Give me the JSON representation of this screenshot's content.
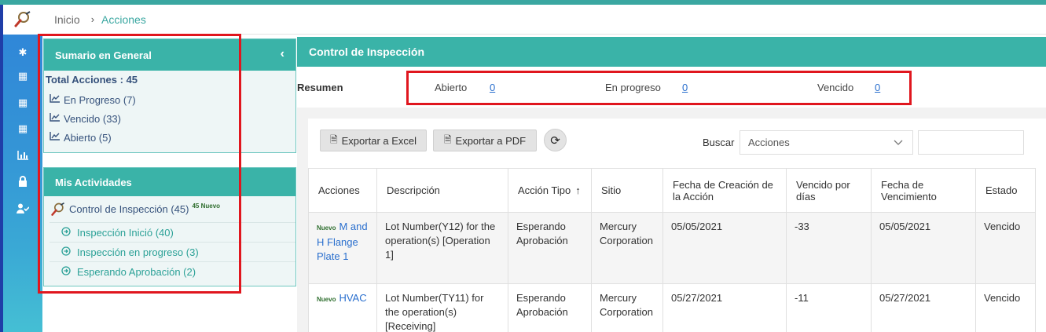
{
  "breadcrumb": {
    "home": "Inicio",
    "separator": "›",
    "current": "Acciones"
  },
  "rail": {
    "icons": [
      "settings-icon",
      "building-icon",
      "building-icon",
      "building-icon",
      "bar-chart-icon",
      "lock-icon",
      "user-check-icon"
    ]
  },
  "summary_card": {
    "title": "Sumario en General",
    "collapse_glyph": "‹",
    "total": "Total Acciones : 45",
    "items": [
      {
        "label": "En Progreso (7)"
      },
      {
        "label": "Vencido (33)"
      },
      {
        "label": "Abierto (5)"
      }
    ]
  },
  "activities_card": {
    "title": "Mis Actividades",
    "main_label": "Control de Inspección (45)",
    "main_badge": "45 Nuevo",
    "subitems": [
      {
        "label": "Inspección Inició (40)"
      },
      {
        "label": "Inspección en progreso (3)"
      },
      {
        "label": "Esperando Aprobación (2)"
      }
    ]
  },
  "main": {
    "title": "Control de Inspección",
    "resumen": {
      "label": "Resumen",
      "items": [
        {
          "label": "Abierto",
          "value": "0"
        },
        {
          "label": "En progreso",
          "value": "0"
        },
        {
          "label": "Vencido",
          "value": "0"
        }
      ]
    },
    "toolbar": {
      "export_excel": "Exportar a Excel",
      "export_pdf": "Exportar a PDF",
      "search_label": "Buscar",
      "search_select": "Acciones",
      "search_value": ""
    },
    "table": {
      "headers": {
        "acciones": "Acciones",
        "descripcion": "Descripción",
        "accion_tipo": "Acción Tipo",
        "sitio": "Sitio",
        "fecha_creacion": "Fecha de Creación de la Acción",
        "vencido_dias": "Vencido por días",
        "fecha_vencimiento": "Fecha de Vencimiento",
        "estado": "Estado"
      },
      "rows": [
        {
          "badge": "Nuevo",
          "accion": "M and H Flange Plate 1",
          "descripcion": "Lot Number(Y12) for the operation(s) [Operation 1]",
          "accion_tipo": "Esperando Aprobación",
          "sitio": "Mercury Corporation",
          "fecha_creacion": "05/05/2021",
          "vencido_dias": "-33",
          "fecha_vencimiento": "05/05/2021",
          "estado": "Vencido"
        },
        {
          "badge": "Nuevo",
          "accion": "HVAC",
          "descripcion": "Lot Number(TY11) for the operation(s) [Receiving]",
          "accion_tipo": "Esperando Aprobación",
          "sitio": "Mercury Corporation",
          "fecha_creacion": "05/27/2021",
          "vencido_dias": "-11",
          "fecha_vencimiento": "05/27/2021",
          "estado": "Vencido"
        }
      ]
    }
  },
  "colors": {
    "accent": "#3ab3a8",
    "link": "#2a6fce",
    "negative": "#d9362b",
    "annotation": "#e0161e"
  }
}
